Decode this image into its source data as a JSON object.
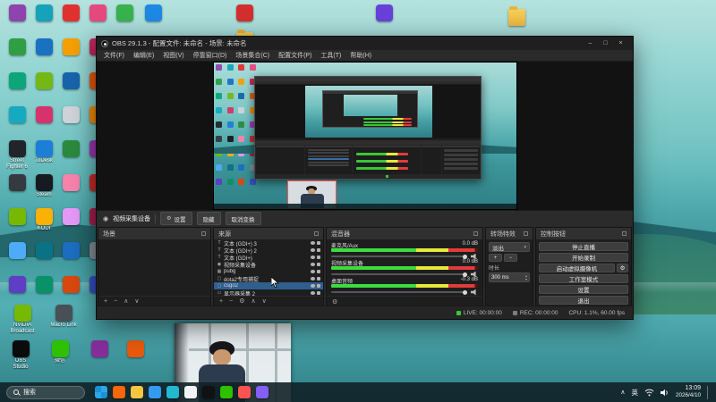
{
  "desktop": {
    "grid": [
      {
        "c": "#8e44ad",
        "l": ""
      },
      {
        "c": "#16a2b8",
        "l": ""
      },
      {
        "c": "#e03131",
        "l": ""
      },
      {
        "c": "#e64980",
        "l": ""
      },
      {
        "c": "#2f9e44",
        "l": ""
      },
      {
        "c": "#1971c2",
        "l": ""
      },
      {
        "c": "#f59f00",
        "l": ""
      },
      {
        "c": "#c2255c",
        "l": ""
      },
      {
        "c": "#0ca678",
        "l": ""
      },
      {
        "c": "#74b816",
        "l": ""
      },
      {
        "c": "#1864ab",
        "l": ""
      },
      {
        "c": "#e8590c",
        "l": ""
      },
      {
        "c": "#15aabf",
        "l": ""
      },
      {
        "c": "#d6336c",
        "l": ""
      },
      {
        "c": "#ced4da",
        "l": ""
      },
      {
        "c": "#f08c00",
        "l": ""
      },
      {
        "c": "#212529",
        "l": "Street Fighter 6"
      },
      {
        "c": "#1c7ed6",
        "l": "ToDesk"
      },
      {
        "c": "#2b8a3e",
        "l": ""
      },
      {
        "c": "#9c36b5",
        "l": ""
      },
      {
        "c": "#343a40",
        "l": ""
      },
      {
        "c": "#171a21",
        "l": "Steam"
      },
      {
        "c": "#f783ac",
        "l": ""
      },
      {
        "c": "#c92a2a",
        "l": ""
      },
      {
        "c": "#76b900",
        "l": ""
      },
      {
        "c": "#fab005",
        "l": "KODI"
      },
      {
        "c": "#e599f7",
        "l": ""
      },
      {
        "c": "#a61e4d",
        "l": ""
      },
      {
        "c": "#4dabf7",
        "l": ""
      },
      {
        "c": "#0b7285",
        "l": ""
      },
      {
        "c": "#1b6ec2",
        "l": ""
      },
      {
        "c": "#868e96",
        "l": ""
      },
      {
        "c": "#5f3dc4",
        "l": ""
      },
      {
        "c": "#099268",
        "l": ""
      },
      {
        "c": "#d9480f",
        "l": ""
      },
      {
        "c": "#364fc7",
        "l": ""
      }
    ],
    "extras": [
      {
        "c": "#37b24d",
        "l": ""
      },
      {
        "c": "#1e88e5",
        "l": ""
      },
      {
        "c": "#d32f2f",
        "l": ""
      },
      {
        "c": "#f5c542",
        "l": "",
        "folder": true
      },
      {
        "c": "#6741d9",
        "l": ""
      },
      {
        "c": "#f5c542",
        "l": "",
        "folder": true
      }
    ],
    "bottom": [
      {
        "c": "#76b900",
        "l": "NVIDIA Broadcast"
      },
      {
        "c": "#495057",
        "l": "Macro Link"
      },
      {
        "c": "#0b0b0d",
        "l": "OBS Studio"
      },
      {
        "c": "#2dc100",
        "l": "微信"
      },
      {
        "c": "#862e9c",
        "l": ""
      },
      {
        "c": "#e8590c",
        "l": ""
      }
    ]
  },
  "obs": {
    "title": "OBS 29.1.3 - 配置文件: 未命名 - 场景: 未命名",
    "window_buttons": {
      "min": "–",
      "max": "□",
      "close": "×"
    },
    "menus": [
      "文件(F)",
      "编辑(E)",
      "视图(V)",
      "停靠窗口(D)",
      "场景集合(C)",
      "配置文件(P)",
      "工具(T)",
      "帮助(H)"
    ],
    "context": {
      "camera_icon": "◉",
      "gear": "⚙",
      "source": "视频采集设备",
      "buttons": [
        "设置",
        "隐藏",
        "取消变换"
      ]
    },
    "scenes": {
      "title": "场景",
      "toolbar": [
        "+",
        "−",
        "∧",
        "∨"
      ]
    },
    "sources": {
      "title": "来源",
      "toolbar": [
        "+",
        "−",
        "⚙",
        "∧",
        "∨"
      ],
      "items": [
        {
          "t": "t",
          "name": "文本 (GDI+) 3",
          "selected": false
        },
        {
          "t": "t",
          "name": "文本 (GDI+) 2",
          "selected": false
        },
        {
          "t": "t",
          "name": "文本 (GDI+)",
          "selected": false
        },
        {
          "t": "cam",
          "name": "视频采集设备",
          "selected": false
        },
        {
          "t": "game",
          "name": "pubg",
          "selected": false
        },
        {
          "t": "win",
          "name": "dota2专用捕捉",
          "selected": false
        },
        {
          "t": "win",
          "name": "csgo2",
          "selected": true
        },
        {
          "t": "mon",
          "name": "显示器采集 2",
          "selected": false
        }
      ]
    },
    "mixer": {
      "title": "混音器",
      "gear": "⚙",
      "channels": [
        {
          "name": "麦克风/Aux",
          "db": "0.0 dB"
        },
        {
          "name": "视频采集设备",
          "db": "0.0 dB"
        },
        {
          "name": "桌面音频",
          "db": "-0.3 dB"
        }
      ]
    },
    "transitions": {
      "title": "转场特效",
      "selected": "淡出",
      "caret": "▾",
      "add": "+",
      "remove": "−",
      "duration_label": "时长",
      "duration": "300 ms",
      "spin_up": "▴",
      "spin_down": "▾"
    },
    "controls": {
      "title": "控制按钮",
      "stream": "停止直播",
      "record": "开始录制",
      "vcam": "启动虚拟摄像机",
      "vcam_gear": "⚙",
      "studio": "工作室模式",
      "settings": "设置",
      "exit": "退出"
    },
    "status": {
      "live": "LIVE: 00:00:00",
      "rec": "REC: 00:00:00",
      "perf": "CPU: 1.1%, 60.00 fps"
    }
  },
  "taskbar": {
    "search": "搜索",
    "apps": [
      {
        "c": "#2aa3ef",
        "start": true
      },
      {
        "c": "#f76707"
      },
      {
        "c": "#f5c542"
      },
      {
        "c": "#339af0"
      },
      {
        "c": "#22b8cf"
      },
      {
        "c": "#f1f3f5"
      },
      {
        "c": "#101113"
      },
      {
        "c": "#2dc100"
      },
      {
        "c": "#fa5252"
      },
      {
        "c": "#845ef7"
      }
    ],
    "tray": {
      "chevron": "∧",
      "lang": "英",
      "time": "13:09",
      "date": "2026/4/10"
    }
  }
}
